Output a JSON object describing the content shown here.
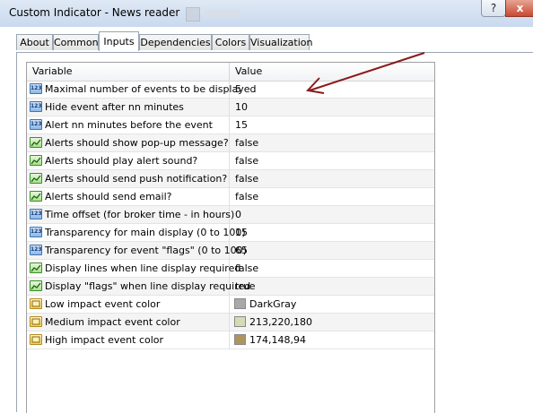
{
  "window": {
    "title": "Custom Indicator - News reader",
    "help_label": "?",
    "close_label": "x"
  },
  "tabs": [
    {
      "label": "About"
    },
    {
      "label": "Common"
    },
    {
      "label": "Inputs",
      "active": true
    },
    {
      "label": "Dependencies"
    },
    {
      "label": "Colors"
    },
    {
      "label": "Visualization"
    }
  ],
  "grid": {
    "columns": {
      "variable": "Variable",
      "value": "Value"
    },
    "rows": [
      {
        "type": "number",
        "name": "Maximal number of events to be displayed",
        "value": "5"
      },
      {
        "type": "number",
        "name": "Hide event after nn minutes",
        "value": "10"
      },
      {
        "type": "number",
        "name": "Alert nn minutes before the event",
        "value": "15"
      },
      {
        "type": "bool",
        "name": "Alerts should show pop-up message?",
        "value": "false"
      },
      {
        "type": "bool",
        "name": "Alerts should play alert sound?",
        "value": "false"
      },
      {
        "type": "bool",
        "name": "Alerts should send push notification?",
        "value": "false"
      },
      {
        "type": "bool",
        "name": "Alerts should send email?",
        "value": "false"
      },
      {
        "type": "number",
        "name": "Time offset (for broker time - in hours)",
        "value": "0"
      },
      {
        "type": "number",
        "name": "Transparency for main display (0 to 100)",
        "value": "15"
      },
      {
        "type": "number",
        "name": "Transparency for event \"flags\" (0 to 100)",
        "value": "65"
      },
      {
        "type": "bool",
        "name": "Display lines when line display required",
        "value": "false"
      },
      {
        "type": "bool",
        "name": "Display \"flags\" when line display required",
        "value": "true"
      },
      {
        "type": "color",
        "name": "Low impact event color",
        "value": "DarkGray",
        "swatch": "#a9a9a9"
      },
      {
        "type": "color",
        "name": "Medium impact event color",
        "value": "213,220,180",
        "swatch": "#d5dcb4"
      },
      {
        "type": "color",
        "name": "High impact event color",
        "value": "174,148,94",
        "swatch": "#ae945e"
      }
    ]
  },
  "icons": {
    "number": "number-type-icon",
    "bool": "bool-type-icon",
    "color": "color-type-icon",
    "number_glyph": "123"
  },
  "annotation": {
    "arrow_color": "#8b1a1a"
  }
}
